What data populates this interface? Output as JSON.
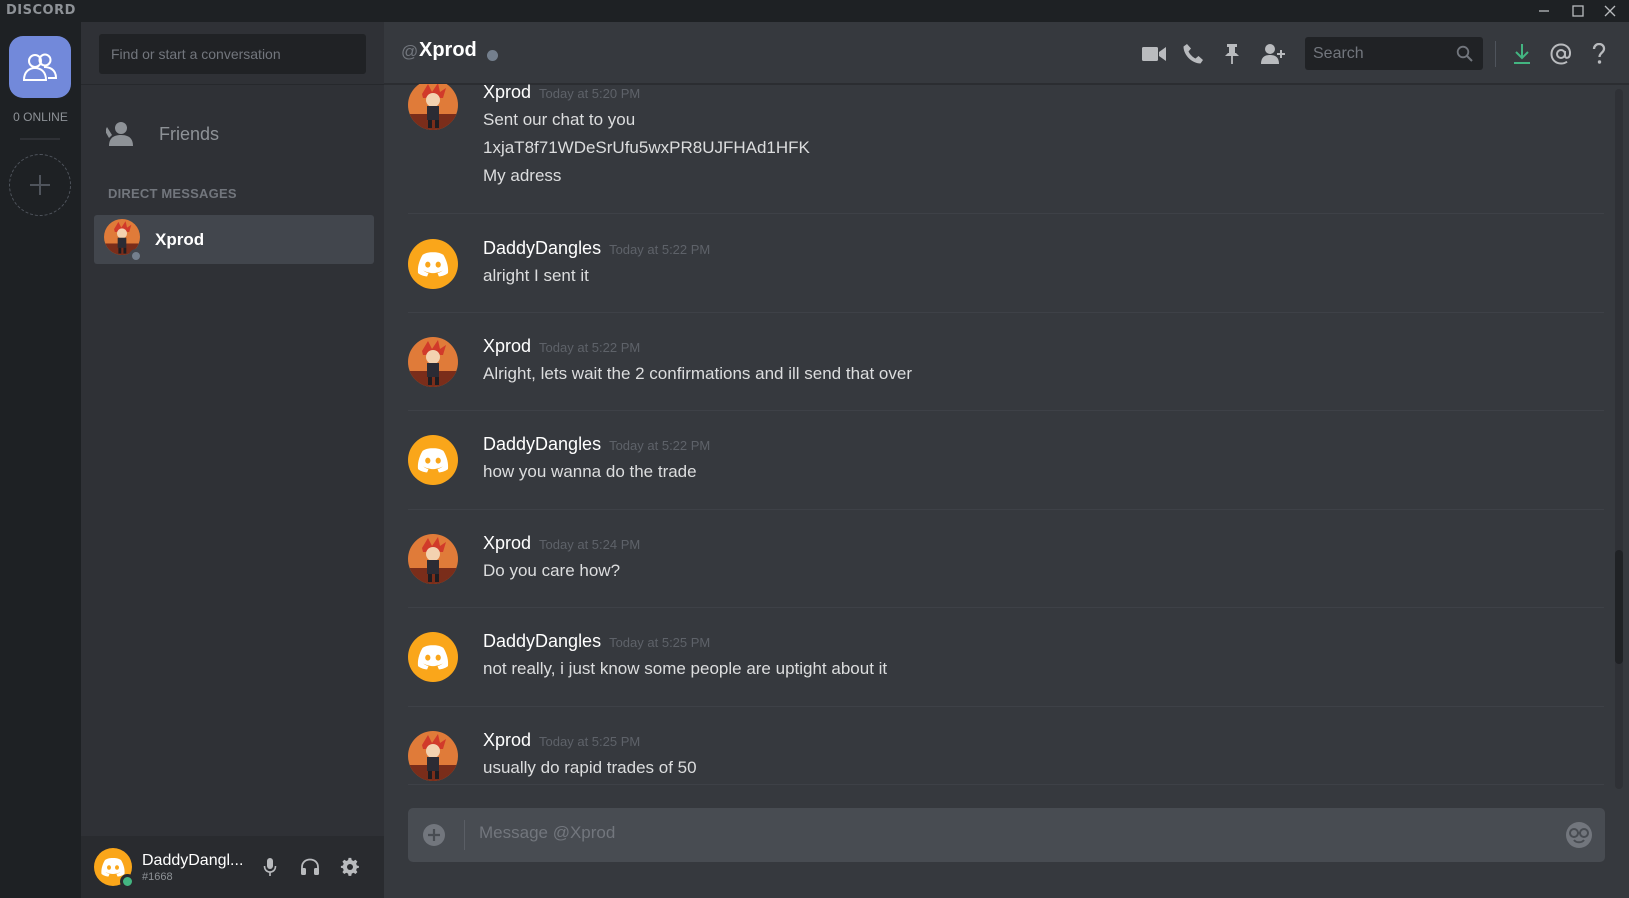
{
  "app": {
    "brand": "DISCORD"
  },
  "guilds": {
    "online_count": "0 ONLINE"
  },
  "dm_panel": {
    "search_placeholder": "Find or start a conversation",
    "friends_label": "Friends",
    "section_title": "DIRECT MESSAGES",
    "items": [
      {
        "name": "Xprod",
        "status": "offline"
      }
    ]
  },
  "user_panel": {
    "username": "DaddyDangl...",
    "tag": "#1668",
    "status": "online"
  },
  "chat": {
    "at_symbol": "@",
    "channel_name": "Xprod",
    "search_placeholder": "Search",
    "composer_placeholder": "Message @Xprod",
    "messages": [
      {
        "author": "Xprod",
        "timestamp": "Today at 5:20 PM",
        "lines": [
          "Sent our chat to you",
          "1xjaT8f71WDeSrUfu5wxPR8UJFHAd1HFK",
          "My adress"
        ]
      },
      {
        "author": "DaddyDangles",
        "timestamp": "Today at 5:22 PM",
        "lines": [
          "alright I sent it"
        ]
      },
      {
        "author": "Xprod",
        "timestamp": "Today at 5:22 PM",
        "lines": [
          "Alright, lets wait the 2 confirmations and ill send that over"
        ]
      },
      {
        "author": "DaddyDangles",
        "timestamp": "Today at 5:22 PM",
        "lines": [
          "how you wanna do the trade"
        ]
      },
      {
        "author": "Xprod",
        "timestamp": "Today at 5:24 PM",
        "lines": [
          "Do you care how?"
        ]
      },
      {
        "author": "DaddyDangles",
        "timestamp": "Today at 5:25 PM",
        "lines": [
          "not really, i just know some people are uptight about it"
        ]
      },
      {
        "author": "Xprod",
        "timestamp": "Today at 5:25 PM",
        "lines": [
          "usually do rapid trades of 50"
        ]
      }
    ]
  },
  "colors": {
    "blurple": "#7289da",
    "discord_orange": "#faa61a",
    "online_green": "#43b581",
    "offline_gray": "#747f8d",
    "download_green": "#43b581"
  }
}
